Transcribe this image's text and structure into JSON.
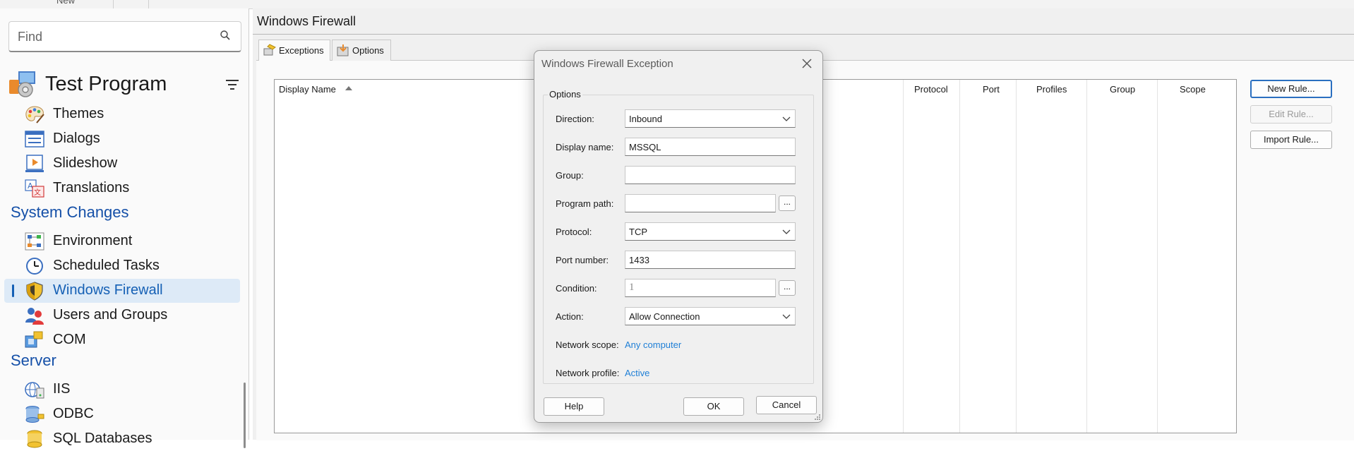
{
  "top_strip": {
    "new_label": "New"
  },
  "sidebar": {
    "search": {
      "placeholder": "Find"
    },
    "project": {
      "title": "Test Program"
    },
    "items_top": [
      {
        "label": "Themes",
        "icon": "palette-icon"
      },
      {
        "label": "Dialogs",
        "icon": "dialog-window-icon"
      },
      {
        "label": "Slideshow",
        "icon": "slideshow-icon"
      },
      {
        "label": "Translations",
        "icon": "translate-icon"
      }
    ],
    "section_system": "System Changes",
    "items_system": [
      {
        "label": "Environment",
        "icon": "environment-icon"
      },
      {
        "label": "Scheduled Tasks",
        "icon": "clock-icon"
      },
      {
        "label": "Windows Firewall",
        "icon": "shield-icon",
        "active": true
      },
      {
        "label": "Users and Groups",
        "icon": "users-icon"
      },
      {
        "label": "COM",
        "icon": "com-component-icon"
      }
    ],
    "section_server": "Server",
    "items_server": [
      {
        "label": "IIS",
        "icon": "iis-icon"
      },
      {
        "label": "ODBC",
        "icon": "odbc-icon"
      },
      {
        "label": "SQL Databases",
        "icon": "database-icon"
      }
    ]
  },
  "main": {
    "title": "Windows Firewall",
    "tabs": [
      {
        "label": "Exceptions",
        "selected": true
      },
      {
        "label": "Options",
        "selected": false
      }
    ],
    "list": {
      "columns": [
        "Display Name",
        "Protocol",
        "Port",
        "Profiles",
        "Group",
        "Scope"
      ],
      "sorted_column": "Display Name"
    },
    "buttons": {
      "new_rule": "New Rule...",
      "edit_rule": "Edit Rule...",
      "import_rule": "Import Rule..."
    }
  },
  "dialog": {
    "title": "Windows Firewall Exception",
    "group_label": "Options",
    "fields": {
      "direction": {
        "label": "Direction:",
        "value": "Inbound"
      },
      "display_name": {
        "label": "Display name:",
        "value": "MSSQL"
      },
      "group": {
        "label": "Group:",
        "value": ""
      },
      "program_path": {
        "label": "Program path:",
        "value": "",
        "browse": "..."
      },
      "protocol": {
        "label": "Protocol:",
        "value": "TCP"
      },
      "port_number": {
        "label": "Port number:",
        "value": "1433"
      },
      "condition": {
        "label": "Condition:",
        "value": "1",
        "browse": "..."
      },
      "action": {
        "label": "Action:",
        "value": "Allow Connection"
      },
      "network_scope": {
        "label": "Network scope:",
        "value": "Any computer"
      },
      "network_profile": {
        "label": "Network profile:",
        "value": "Active"
      }
    },
    "buttons": {
      "help": "Help",
      "ok": "OK",
      "cancel": "Cancel"
    }
  },
  "colors": {
    "accent": "#1560b5",
    "link": "#1f7fd6",
    "selection_bg": "#ddeaf7"
  }
}
